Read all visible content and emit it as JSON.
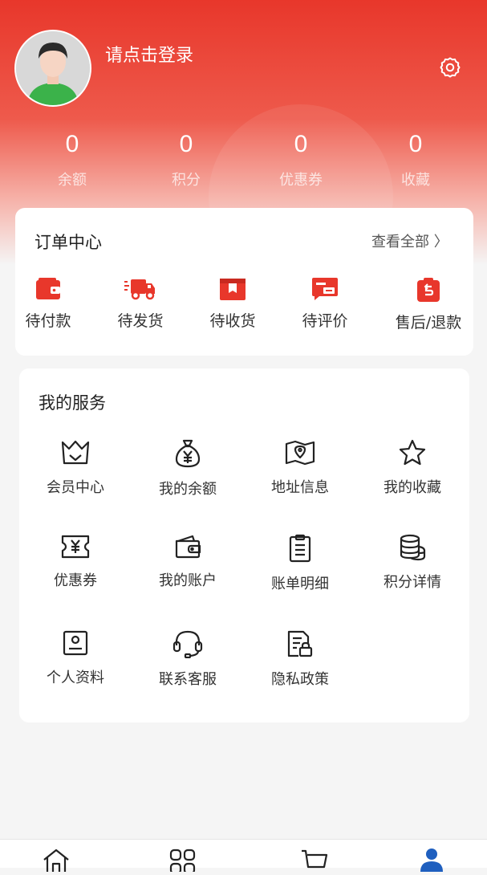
{
  "profile": {
    "login_text": "请点击登录"
  },
  "stats": [
    {
      "value": "0",
      "label": "余额"
    },
    {
      "value": "0",
      "label": "积分"
    },
    {
      "value": "0",
      "label": "优惠券"
    },
    {
      "value": "0",
      "label": "收藏"
    }
  ],
  "orders": {
    "title": "订单中心",
    "view_all": "查看全部 〉",
    "items": [
      {
        "label": "待付款",
        "icon": "wallet-icon"
      },
      {
        "label": "待发货",
        "icon": "truck-icon"
      },
      {
        "label": "待收货",
        "icon": "package-icon"
      },
      {
        "label": "待评价",
        "icon": "review-icon"
      },
      {
        "label": "售后/退款",
        "icon": "refund-icon"
      }
    ]
  },
  "services": {
    "title": "我的服务",
    "items": [
      {
        "label": "会员中心",
        "icon": "crown-icon"
      },
      {
        "label": "我的余额",
        "icon": "money-bag-icon"
      },
      {
        "label": "地址信息",
        "icon": "map-icon"
      },
      {
        "label": "我的收藏",
        "icon": "star-icon"
      },
      {
        "label": "优惠券",
        "icon": "coupon-icon"
      },
      {
        "label": "我的账户",
        "icon": "wallet-outline-icon"
      },
      {
        "label": "账单明细",
        "icon": "clipboard-icon"
      },
      {
        "label": "积分详情",
        "icon": "coins-icon"
      },
      {
        "label": "个人资料",
        "icon": "id-card-icon"
      },
      {
        "label": "联系客服",
        "icon": "headset-icon"
      },
      {
        "label": "隐私政策",
        "icon": "privacy-doc-icon"
      }
    ]
  },
  "tabbar": [
    "home-icon",
    "category-icon",
    "cart-icon",
    "user-icon"
  ],
  "colors": {
    "accent": "#e8372b",
    "tab_active": "#1f5fbf"
  }
}
